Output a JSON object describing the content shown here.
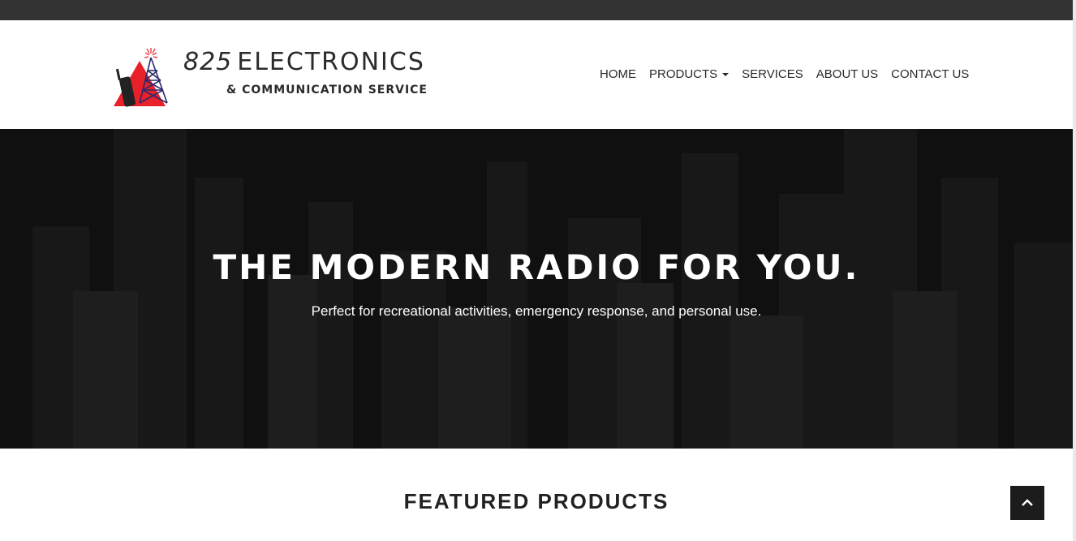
{
  "brand": {
    "number": "825",
    "name": "ELECTRONICS",
    "tagline": "& COMMUNICATION SERVICE"
  },
  "nav": {
    "home": "HOME",
    "products": "PRODUCTS",
    "services": "SERVICES",
    "about": "ABOUT US",
    "contact": "CONTACT US"
  },
  "hero": {
    "title": "THE MODERN RADIO FOR YOU.",
    "subtitle": "Perfect for recreational activities, emergency response, and personal use."
  },
  "sections": {
    "featured_title": "FEATURED PRODUCTS"
  },
  "icons": {
    "logo": "radio-tower-logo-icon",
    "dropdown": "caret-down-icon",
    "back_to_top": "chevron-up-icon"
  },
  "colors": {
    "topbar": "#333333",
    "brand_red": "#e8202a",
    "brand_navy": "#2d2a6b",
    "hero_bg": "#1b1b1b",
    "button": "#1c1c1c"
  }
}
